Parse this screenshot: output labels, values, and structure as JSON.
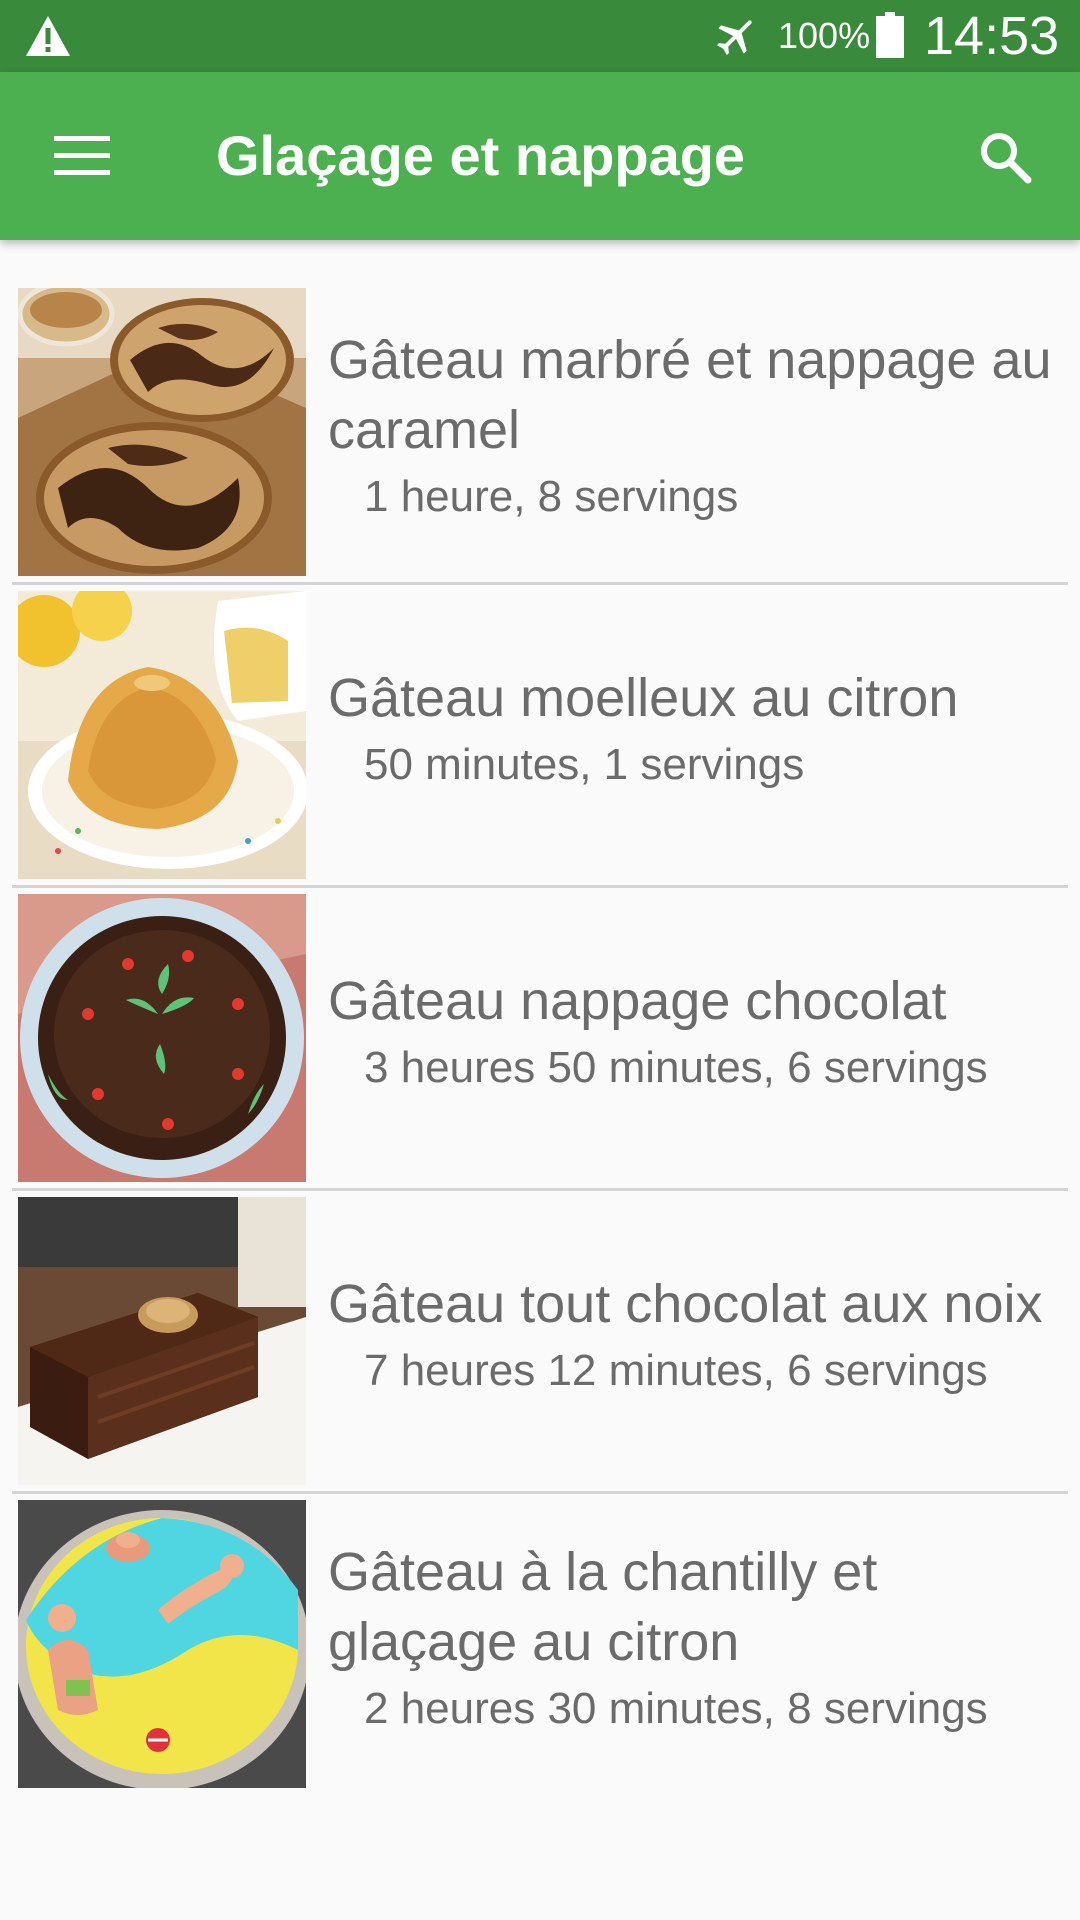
{
  "status_bar": {
    "battery": "100%",
    "time": "14:53",
    "icons": [
      "warning-icon",
      "airplane-mode-icon",
      "battery-icon"
    ]
  },
  "app_bar": {
    "title": "Glaçage et nappage",
    "icons": [
      "menu-icon",
      "search-icon"
    ]
  },
  "recipes": [
    {
      "title": "Gâteau marbré et nappage au caramel",
      "meta": "1 heure, 8 servings"
    },
    {
      "title": "Gâteau moelleux au citron",
      "meta": "50 minutes, 1 servings"
    },
    {
      "title": "Gâteau nappage chocolat",
      "meta": "3 heures 50 minutes, 6 servings"
    },
    {
      "title": "Gâteau tout chocolat aux noix",
      "meta": "7 heures 12 minutes, 6 servings"
    },
    {
      "title": "Gâteau à la chantilly et glaçage au citron",
      "meta": "2 heures 30 minutes, 8 servings"
    }
  ],
  "colors": {
    "status_bar": "#3a8a3c",
    "app_bar": "#4caf50",
    "background": "#fafafa",
    "text": "#6b6b6b",
    "divider": "#d4d4d4"
  }
}
